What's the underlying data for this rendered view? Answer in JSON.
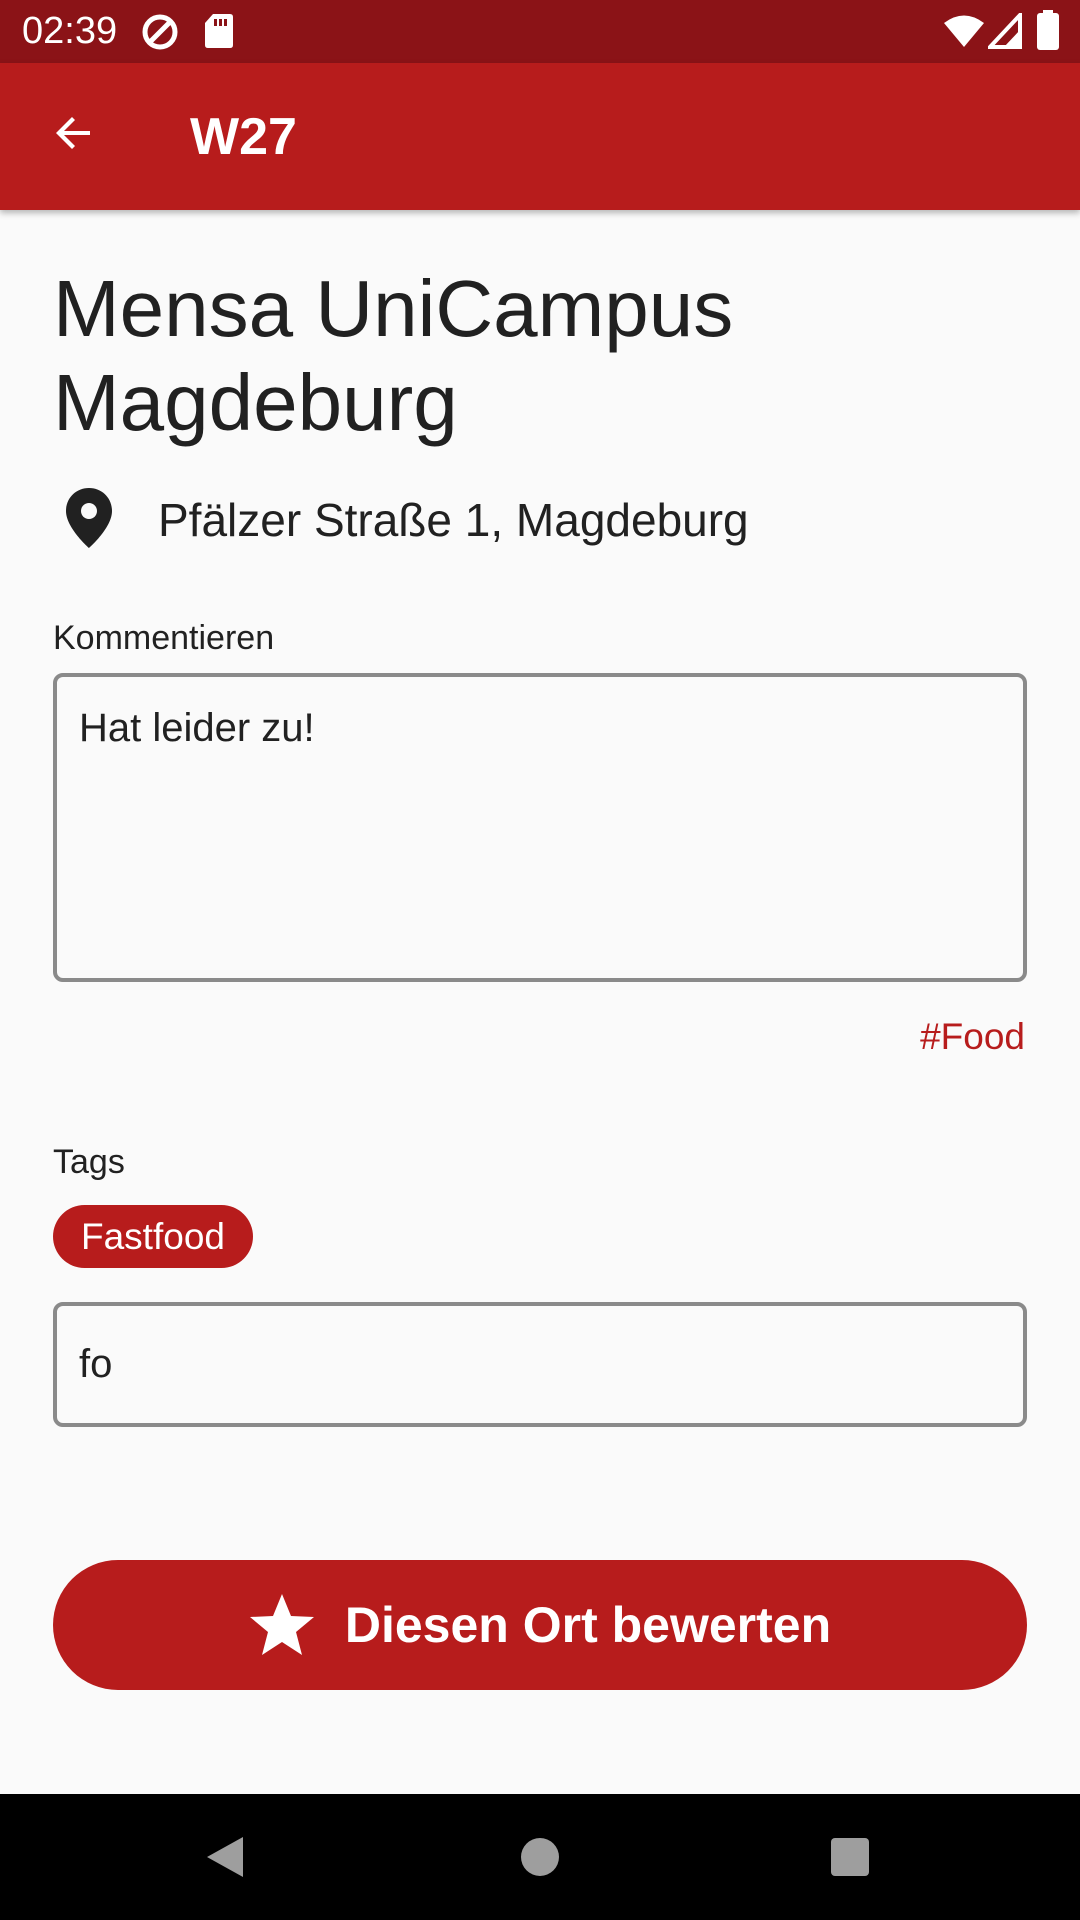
{
  "status_bar": {
    "time": "02:39",
    "left_icons": [
      "data-saver-icon",
      "sd-card-icon"
    ],
    "right_icons": [
      "wifi-icon",
      "cellular-signal-icon",
      "battery-icon"
    ]
  },
  "app_bar": {
    "title": "W27",
    "back_icon": "arrow-back-icon"
  },
  "place": {
    "name": "Mensa UniCampus Magdeburg",
    "address": "Pfälzer Straße 1, Magdeburg",
    "address_icon": "location-pin-icon"
  },
  "comment": {
    "label": "Kommentieren",
    "value": "Hat leider zu!",
    "hashtag_link": "#Food"
  },
  "tags": {
    "label": "Tags",
    "chips": [
      "Fastfood"
    ],
    "input_value": "fo"
  },
  "rate_button": {
    "label": "Diesen Ort bewerten",
    "icon": "star-icon"
  },
  "nav_bar": {
    "buttons": [
      "back-triangle-icon",
      "home-circle-icon",
      "recents-square-icon"
    ]
  },
  "colors": {
    "primary": "#b71c1c",
    "status_bar": "#8b1317",
    "background": "#fafafa",
    "field_border": "#8a8a8a"
  }
}
